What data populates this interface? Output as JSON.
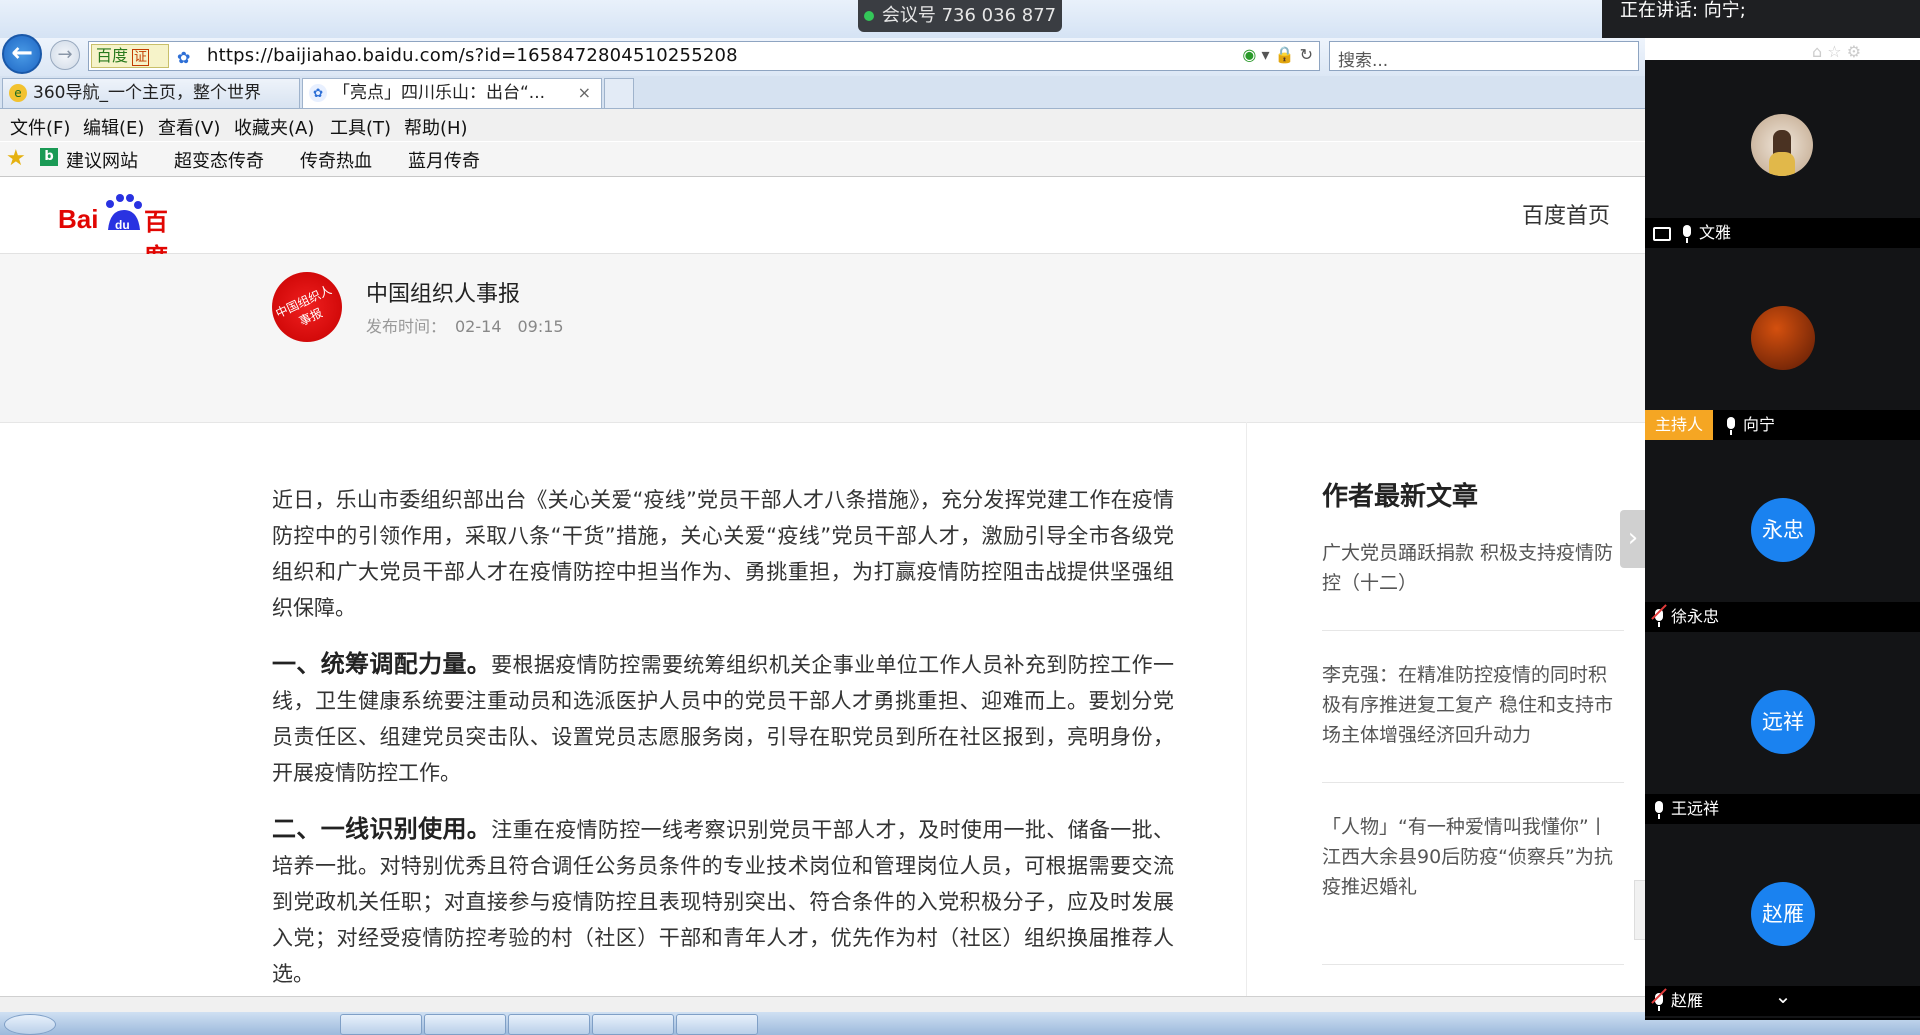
{
  "meeting": {
    "badge": "会议号 736 036 877",
    "speaking": "正在讲话: 向宁;",
    "participants": [
      {
        "name": "文雅",
        "avatar_text": "",
        "role": "",
        "muted": false,
        "sharing": true
      },
      {
        "name": "向宁",
        "avatar_text": "",
        "role": "主持人",
        "muted": false,
        "sharing": false
      },
      {
        "name": "徐永忠",
        "avatar_text": "永忠",
        "role": "",
        "muted": true,
        "sharing": false
      },
      {
        "name": "王远祥",
        "avatar_text": "远祥",
        "role": "",
        "muted": false,
        "sharing": false
      },
      {
        "name": "赵雁",
        "avatar_text": "赵雁",
        "role": "",
        "muted": true,
        "sharing": false
      }
    ]
  },
  "browser": {
    "cert_label": "百度",
    "cert_badge": "证",
    "url": "https://baijiahao.baidu.com/s?id=1658472804510255208",
    "search_placeholder": "搜索...",
    "tabs": [
      {
        "label": "360导航_一个主页，整个世界"
      },
      {
        "label": "「亮点」四川乐山：出台“..."
      }
    ],
    "tab_close": "×",
    "menu": [
      "文件(F)",
      "编辑(E)",
      "查看(V)",
      "收藏夹(A)",
      "工具(T)",
      "帮助(H)"
    ],
    "favorites": [
      "建议网站",
      "超变态传奇",
      "传奇热血",
      "蓝月传奇"
    ]
  },
  "page": {
    "logo_text": "百度",
    "home_link": "百度首页",
    "author": "中国组织人事报",
    "author_seal": "中国组织人事报",
    "publish_label": "发布时间：",
    "publish_time": "02-14　09:15",
    "article": {
      "intro": "近日，乐山市委组织部出台《关心关爱“疫线”党员干部人才八条措施》，充分发挥党建工作在疫情防控中的引领作用，采取八条“干货”措施，关心关爱“疫线”党员干部人才，激励引导全市各级党组织和广大党员干部人才在疫情防控中担当作为、勇挑重担，为打赢疫情防控阻击战提供坚强组织保障。",
      "sections": [
        {
          "heading": "一、统筹调配力量。",
          "text": "要根据疫情防控需要统筹组织机关企事业单位工作人员补充到防控工作一线，卫生健康系统要注重动员和选派医护人员中的党员干部人才勇挑重担、迎难而上。要划分党员责任区、组建党员突击队、设置党员志愿服务岗，引导在职党员到所在社区报到，亮明身份，开展疫情防控工作。"
        },
        {
          "heading": "二、一线识别使用。",
          "text": "注重在疫情防控一线考察识别党员干部人才，及时使用一批、储备一批、培养一批。对特别优秀且符合调任公务员条件的专业技术岗位和管理岗位人员，可根据需要交流到党政机关任职；对直接参与疫情防控且表现特别突出、符合条件的入党积极分子，应及时发展入党；对经受疫情防控考验的村（社区）干部和青年人才，优先作为村（社区）组织换届推荐人选。"
        }
      ]
    },
    "sidebar": {
      "title": "作者最新文章",
      "items": [
        "广大党员踊跃捐款 积极支持疫情防控（十二）",
        "李克强：在精准防控疫情的同时积极有序推进复工复产 稳住和支持市场主体增强经济回升动力",
        "「人物」“有一种爱情叫我懂你”丨江西大余县90后防疫“侦察兵”为抗疫推迟婚礼"
      ]
    }
  }
}
